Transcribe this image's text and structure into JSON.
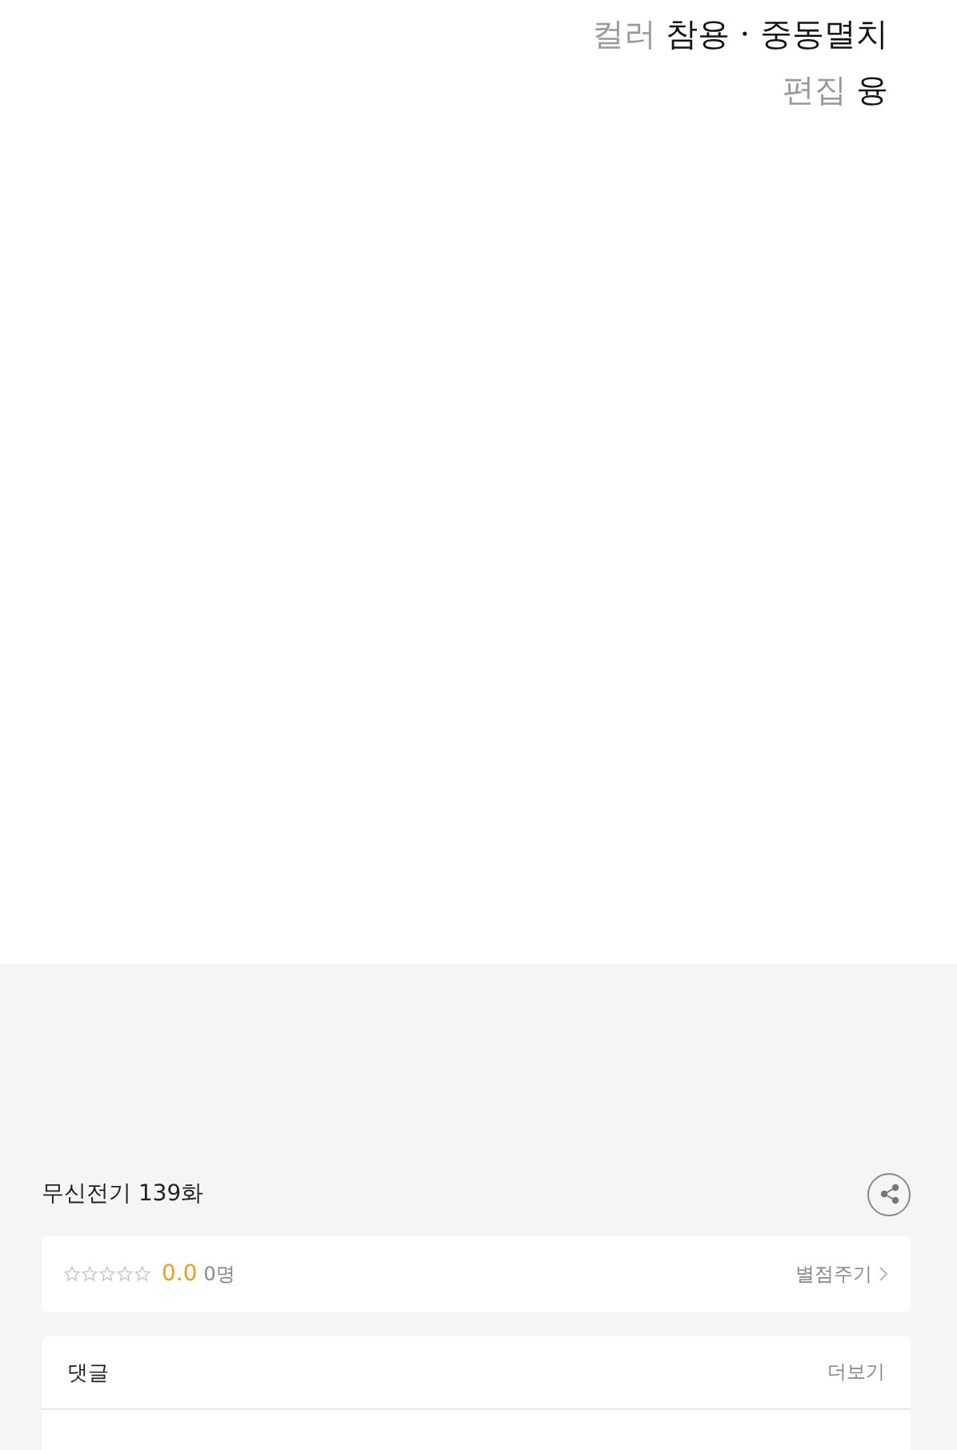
{
  "credits": [
    {
      "role": "컬러",
      "names": "참용 · 중동멸치"
    },
    {
      "role": "편집",
      "names": "융"
    }
  ],
  "episode": {
    "title": "무신전기 139화"
  },
  "rating": {
    "stars": 0,
    "score": "0.0",
    "count": "0명",
    "action": "별점주기"
  },
  "comments": {
    "title": "댓글",
    "more": "더보기"
  }
}
